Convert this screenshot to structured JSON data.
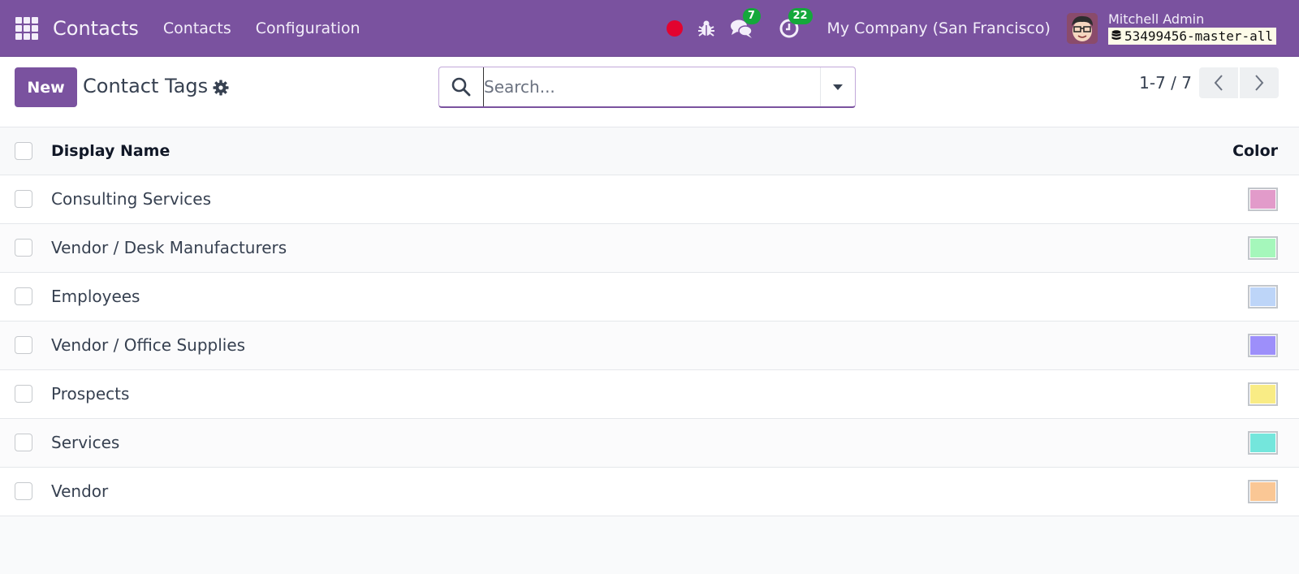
{
  "navbar": {
    "app_name": "Contacts",
    "menu": [
      "Contacts",
      "Configuration"
    ],
    "icons": [
      "apps-grid-icon",
      "recording-dot-icon",
      "bug-icon",
      "chat-icon",
      "activity-clock-icon"
    ],
    "messages_count": "7",
    "activities_count": "22",
    "company": "My Company (San Francisco)",
    "user_name": "Mitchell Admin",
    "database": "53499456-master-all",
    "accent_color": "#7a529f",
    "badge_color": "#14a83b",
    "record_color": "#e3032f"
  },
  "control_panel": {
    "new_label": "New",
    "title": "Contact Tags",
    "search_placeholder": "Search...",
    "search_value": "",
    "pager": "1-7 / 7"
  },
  "table": {
    "columns": [
      "Display Name",
      "Color"
    ],
    "rows": [
      {
        "name": "Consulting Services",
        "color": "#e29bca"
      },
      {
        "name": "Vendor / Desk Manufacturers",
        "color": "#a5f7bb"
      },
      {
        "name": "Employees",
        "color": "#bdd5f8"
      },
      {
        "name": "Vendor / Office Supplies",
        "color": "#9d8ffa"
      },
      {
        "name": "Prospects",
        "color": "#f9ec85"
      },
      {
        "name": "Services",
        "color": "#74e6dc"
      },
      {
        "name": "Vendor",
        "color": "#fac795"
      }
    ]
  }
}
